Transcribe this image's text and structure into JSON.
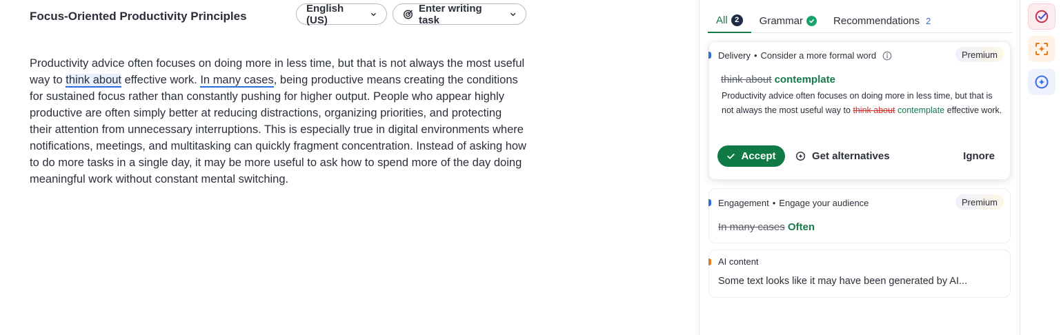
{
  "document": {
    "title": "Focus-Oriented Productivity Principles",
    "language_label": "English (US)",
    "task_label": "Enter writing task",
    "body": {
      "part1": "Productivity advice often focuses on doing more in less time, but that is not always the most useful way to ",
      "highlight1": "think about",
      "part2": " effective work. ",
      "highlight2": "In many cases",
      "part3": ", being productive means creating the conditions for sustained focus rather than constantly pushing for higher output. People who appear highly productive are often simply better at reducing distractions, organizing priorities, and protecting their attention from unnecessary interruptions. This is especially true in digital environments where notifications, meetings, and multitasking can quickly fragment concentration. Instead of asking how to do more tasks in a single day, it may be more useful to ask how to spend more of the day doing meaningful work without constant mental switching."
    }
  },
  "panel": {
    "tabs": [
      {
        "label": "All",
        "count": "2",
        "active": true
      },
      {
        "label": "Grammar",
        "status": "check",
        "active": false
      },
      {
        "label": "Recommendations",
        "count": "2",
        "active": false
      }
    ],
    "cards": [
      {
        "category": "Delivery",
        "summary": "Consider a more formal word",
        "badge": "Premium",
        "old_text": "think about",
        "new_text": "contemplate",
        "preview_before": "Productivity advice often focuses on doing more in less time, but that is not always the most useful way to ",
        "preview_strike": "think about",
        "preview_new": "contemplate",
        "preview_after": " effective work.",
        "accept_label": "Accept",
        "alternatives_label": "Get alternatives",
        "ignore_label": "Ignore"
      },
      {
        "category": "Engagement",
        "summary": "Engage your audience",
        "badge": "Premium",
        "old_text": "In many cases",
        "new_text": "Often"
      },
      {
        "category": "AI content",
        "text": "Some text looks like it may have been generated by AI..."
      }
    ]
  },
  "icons": {
    "language_chevron": "chevron-down-icon",
    "task": "target-icon",
    "grammar_status": "check-circle-icon",
    "info": "info-icon",
    "accept": "check-icon",
    "alternatives": "sparkle-plus-icon",
    "rail": [
      "check-circle-icon",
      "scan-icon",
      "ai-sparkle-icon"
    ]
  },
  "colors": {
    "accent_green": "#16794a",
    "accept_green": "#0f7a45",
    "highlight_blue": "#2b6fd6",
    "strike_red": "#d0302f",
    "ai_orange": "#e57a19"
  }
}
